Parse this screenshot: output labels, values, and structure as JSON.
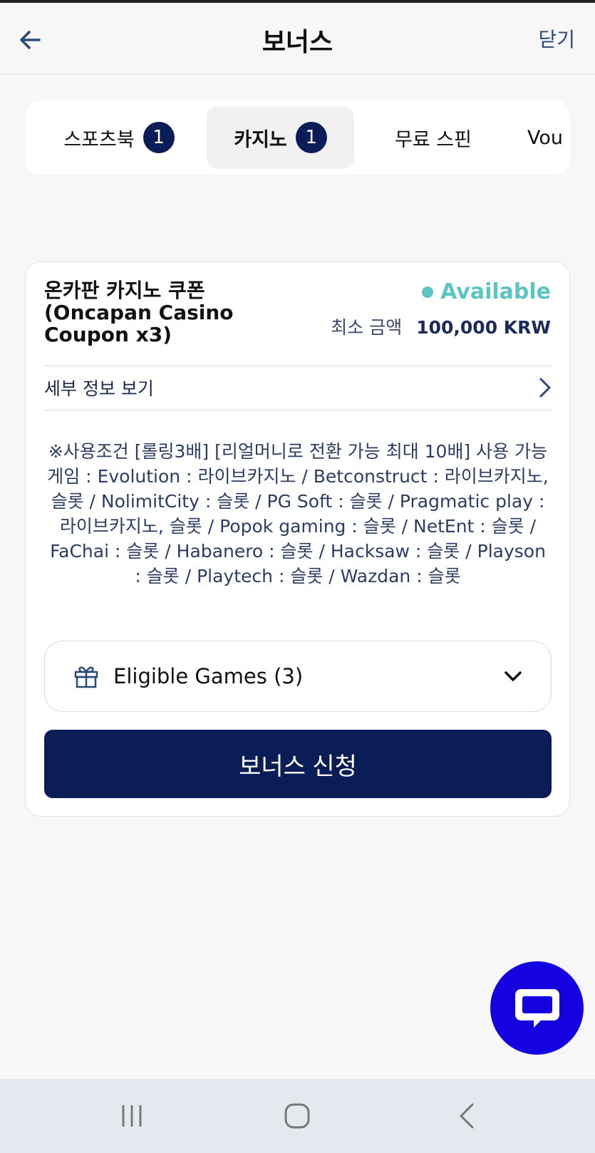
{
  "header": {
    "title": "보너스",
    "close_label": "닫기"
  },
  "tabs": [
    {
      "label": "스포츠북",
      "badge": "1",
      "active": false
    },
    {
      "label": "카지노",
      "badge": "1",
      "active": true
    },
    {
      "label": "무료 스핀",
      "badge": "",
      "active": false
    },
    {
      "label": "Vou",
      "badge": "",
      "active": false
    }
  ],
  "bonus_card": {
    "title": "온카판 카지노 쿠폰 (Oncapan Casino Coupon x3)",
    "status": "Available",
    "min_amount_label": "최소 금액",
    "min_amount_value": "100,000 KRW",
    "details_label": "세부 정보 보기",
    "description": "※사용조건 [롤링3배] [리얼머니로 전환 가능 최대 10배] 사용 가능 게임 : Evolution : 라이브카지노 / Betconstruct : 라이브카지노, 슬롯 / NolimitCity : 슬롯 / PG Soft : 슬롯 / Pragmatic play : 라이브카지노, 슬롯 / Popok gaming : 슬롯 / NetEnt : 슬롯 / FaChai : 슬롯 / Habanero : 슬롯 / Hacksaw : 슬롯 / Playson : 슬롯 / Playtech : 슬롯 / Wazdan : 슬롯",
    "eligible_games_label": "Eligible Games (3)",
    "apply_label": "보너스 신청"
  },
  "colors": {
    "primary": "#0b1d57",
    "available": "#5ec4c3",
    "chat": "#1500e0"
  },
  "icons": {
    "back": "arrow-left-icon",
    "details": "chevron-right-icon",
    "gift": "gift-icon",
    "dropdown": "chevron-down-icon",
    "chat": "chat-bubble-icon",
    "nav_recent": "recent-apps-icon",
    "nav_home": "home-icon",
    "nav_back": "nav-back-icon"
  }
}
